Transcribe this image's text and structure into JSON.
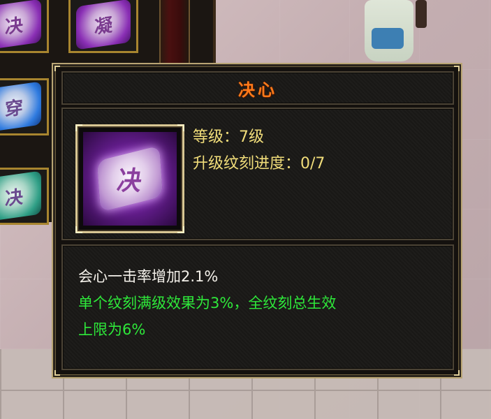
{
  "inventory": {
    "slots": [
      {
        "glyph": "决",
        "color": "purple"
      },
      {
        "glyph": "凝",
        "color": "purple"
      },
      {
        "glyph": "穿",
        "color": "blue"
      },
      {
        "glyph": "决",
        "color": "teal"
      }
    ]
  },
  "tooltip": {
    "title": "决心",
    "icon_glyph": "决",
    "icon": "rune-gem-icon",
    "level": "等级：7级",
    "progress": "升级纹刻进度：0/7",
    "desc": [
      "会心一击率增加2.1%",
      "单个纹刻满级效果为3%，全纹刻总生效",
      "上限为6%"
    ]
  },
  "colors": {
    "title": "#ff7a1a",
    "stat_text": "#f1dd7a",
    "effect_text": "#f4f1ea",
    "note_text": "#2ee83a",
    "frame_border": "#b9a574"
  }
}
